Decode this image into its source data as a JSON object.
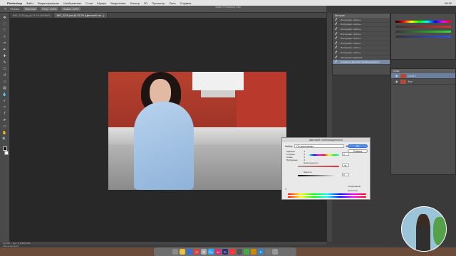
{
  "menubar": {
    "app": "Photoshop",
    "items": [
      "Файл",
      "Редактирование",
      "Изображение",
      "Слои",
      "Шрифт",
      "Выделение",
      "Фильтр",
      "3D",
      "Просмотр",
      "Окно",
      "Справка"
    ],
    "clock": "08:30"
  },
  "window": {
    "title": "Adobe Photoshop CS6"
  },
  "options": {
    "mode": "Режим:",
    "mode_value": "Обычный",
    "opacity": "Непр.: 100%",
    "flow": "Нажим: 100%"
  },
  "tabs": [
    {
      "label": "IMG_3215.jpg @ 33,3% (RGB/8*)"
    },
    {
      "label": "IMG_3215.psd @ 33,3% (Цветовой тон...)"
    }
  ],
  "history": {
    "title": "История",
    "items": [
      "Инструмент «Кисть»",
      "Инструмент «Кисть»",
      "Инструмент «Кисть»",
      "Инструмент «Кисть»",
      "Инструмент «Кисть»",
      "Инструмент «Кисть»",
      "Инструмент «Кисть»",
      "Инструмент «Кисть»",
      "Инструмент «Кисть»",
      "Инструмент «Кисть»",
      "Инструмент «Кисть»",
      "Объединить видимые"
    ],
    "active_item": "Создание Цветовой тон/насыщенность"
  },
  "layers": {
    "title": "Слои",
    "rows": [
      "Слой 1",
      "Фон"
    ]
  },
  "dialog": {
    "title": "Цветовой тон/Насыщенность",
    "preset_label": "Набор:",
    "preset_value": "По умолчанию",
    "ok": "OK",
    "cancel": "Отмена",
    "channels": [
      "Красные",
      "Голубые",
      "Синие",
      "Пурпурные"
    ],
    "hue_label": "Цветовой тон:",
    "hue_value": "0",
    "sat_label": "Насыщенность:",
    "sat_value": "-36",
    "light_label": "Яркость:",
    "light_value": "0",
    "colorize_label": "Тонирование",
    "preview_label": "Просмотр"
  },
  "statusbar": {
    "zoom": "33,33%",
    "doc": "Док: 6,18M/6,18M"
  },
  "timeline": {
    "label": "Шкала времени"
  },
  "colors": {
    "accent": "#4c8cf5",
    "photoshop_bg": "#282828",
    "brick": "#b93a2c",
    "coat": "#b8d3ef"
  }
}
